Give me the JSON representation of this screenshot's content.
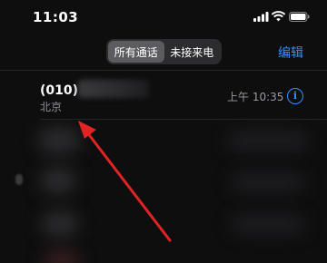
{
  "status_bar": {
    "time": "11:03"
  },
  "segmented": {
    "all_calls": "所有通话",
    "missed_calls": "未接来电"
  },
  "header": {
    "edit": "编辑"
  },
  "calls": [
    {
      "number_prefix": "(010)",
      "location": "北京",
      "time": "上午 10:35",
      "info_glyph": "i"
    }
  ],
  "colors": {
    "accent": "#3a8dff",
    "annotation_arrow": "#e02424",
    "background": "#0e0e0f"
  },
  "icons": [
    "cellular-signal-icon",
    "wifi-icon",
    "battery-icon",
    "info-icon",
    "phone-handset-icon"
  ]
}
